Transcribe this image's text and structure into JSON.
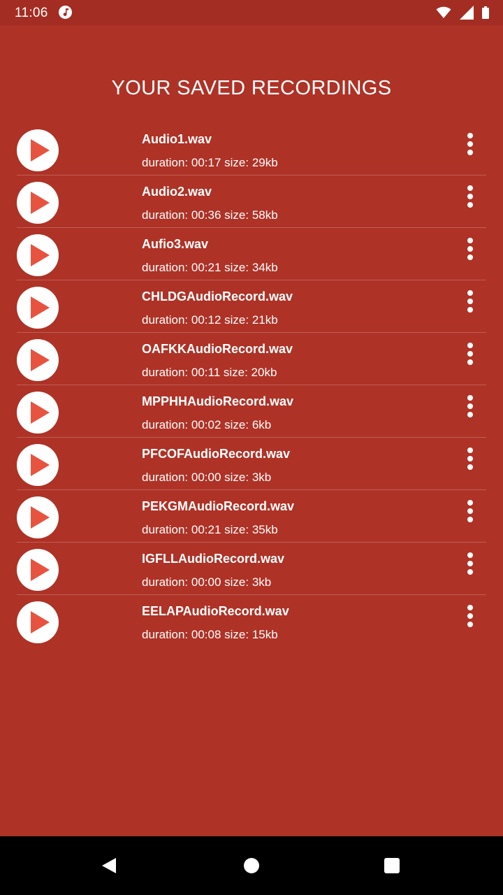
{
  "status_bar": {
    "time": "11:06",
    "icons": [
      "music-note-icon",
      "wifi-icon",
      "signal-icon",
      "battery-icon"
    ]
  },
  "page": {
    "title": "YOUR SAVED RECORDINGS"
  },
  "recordings": [
    {
      "name": "Audio1.wav",
      "meta": "duration: 00:17 size: 29kb"
    },
    {
      "name": "Audio2.wav",
      "meta": "duration: 00:36 size: 58kb"
    },
    {
      "name": "Aufio3.wav",
      "meta": "duration: 00:21 size: 34kb"
    },
    {
      "name": "CHLDGAudioRecord.wav",
      "meta": "duration: 00:12 size: 21kb"
    },
    {
      "name": "OAFKKAudioRecord.wav",
      "meta": "duration: 00:11 size: 20kb"
    },
    {
      "name": "MPPHHAudioRecord.wav",
      "meta": "duration: 00:02 size: 6kb"
    },
    {
      "name": "PFCOFAudioRecord.wav",
      "meta": "duration: 00:00 size: 3kb"
    },
    {
      "name": "PEKGMAudioRecord.wav",
      "meta": "duration: 00:21 size: 35kb"
    },
    {
      "name": "IGFLLAudioRecord.wav",
      "meta": "duration: 00:00 size: 3kb"
    },
    {
      "name": "EELAPAudioRecord.wav",
      "meta": "duration: 00:08 size: 15kb"
    }
  ],
  "colors": {
    "background": "#ae3226",
    "status_bar": "#a32d22",
    "play_icon": "#e8533f",
    "text": "#ffffff",
    "nav_bar": "#000000"
  },
  "nav_bar": {
    "icons": [
      "back-icon",
      "home-icon",
      "recents-icon"
    ]
  }
}
